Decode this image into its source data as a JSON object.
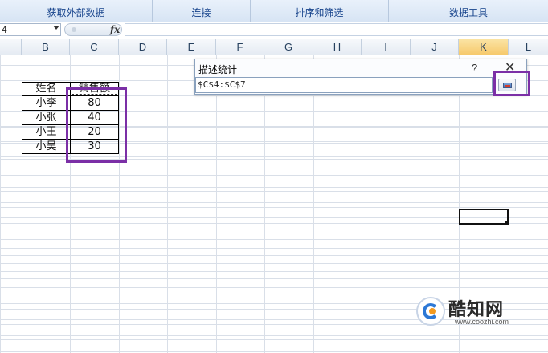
{
  "ribbon": {
    "groups": [
      {
        "label": "获取外部数据"
      },
      {
        "label": "连接"
      },
      {
        "label": "排序和筛选"
      },
      {
        "label": "数据工具"
      }
    ]
  },
  "formula_bar": {
    "name_box": "4",
    "fx_label": "fx",
    "formula": ""
  },
  "columns": [
    "B",
    "C",
    "D",
    "E",
    "F",
    "G",
    "H",
    "I",
    "J",
    "K",
    "L"
  ],
  "active_column": "K",
  "table": {
    "header": [
      "姓名",
      "销售额"
    ],
    "rows": [
      [
        "小李",
        "80"
      ],
      [
        "小张",
        "40"
      ],
      [
        "小王",
        "20"
      ],
      [
        "小吴",
        "30"
      ]
    ]
  },
  "dialog": {
    "title": "描述统计",
    "help": "?",
    "close": "✕",
    "range": "$C$4:$C$7"
  },
  "watermark": {
    "name": "酷知网",
    "url": "www.coozhi.com"
  },
  "colors": {
    "highlight": "#7b2fa6",
    "ribbon_text": "#15428b",
    "active_column_header": "#f6c86a"
  }
}
